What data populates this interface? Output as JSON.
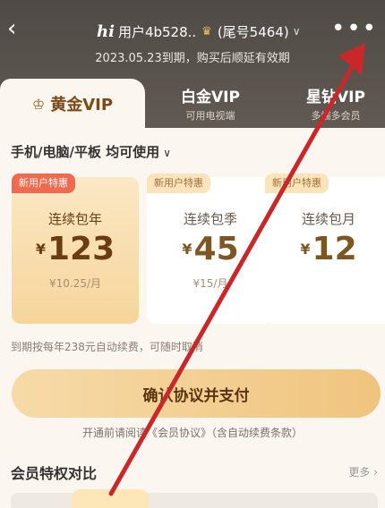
{
  "header": {
    "back_icon": "‹",
    "hi_logo": "hi",
    "username": "用户4b528..",
    "tail_number": "(尾号5464)",
    "more_icon": "•••",
    "expire_text": "2023.05.23到期，购买后顺延有效期"
  },
  "tabs": [
    {
      "label": "黄金VIP",
      "sub": ""
    },
    {
      "label": "白金VIP",
      "sub": "可用电视端"
    },
    {
      "label": "星钻VIP",
      "sub": "多端多会员"
    }
  ],
  "devices": "手机/电脑/平板 均可使用",
  "plans": [
    {
      "badge": "新用户特惠",
      "name": "连续包年",
      "currency": "¥",
      "price": "123",
      "per_month": "¥10.25/月",
      "selected": true
    },
    {
      "badge": "新用户特惠",
      "name": "连续包季",
      "currency": "¥",
      "price": "45",
      "per_month": "¥15/月",
      "selected": false
    },
    {
      "badge": "新用户特惠",
      "name": "连续包月",
      "currency": "¥",
      "price": "12",
      "per_month": "",
      "selected": false
    }
  ],
  "renew_note": "到期按每年238元自动续费，可随时取消",
  "pay_button": "确认协议并支付",
  "agreement": "开通前请阅读《会员协议》（含自动续费条款）",
  "compare_title": "会员特权对比",
  "more_link": "更多 ›",
  "colors": {
    "accent": "#f0c47e",
    "arrow": "#c8282a",
    "header": "#585049"
  }
}
